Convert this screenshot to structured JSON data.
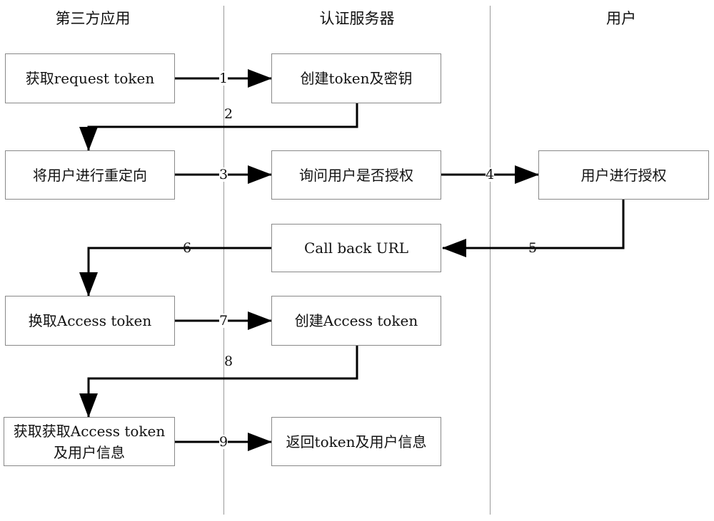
{
  "lanes": [
    {
      "title": "第三方应用"
    },
    {
      "title": "认证服务器"
    },
    {
      "title": "用户"
    }
  ],
  "boxes": {
    "get_request_token": "获取request token",
    "create_token_key": "创建token及密钥",
    "redirect_user": "将用户进行重定向",
    "ask_authorize": "询问用户是否授权",
    "user_authorize": "用户进行授权",
    "callback_url": "Call back URL",
    "exchange_access_token": "换取Access token",
    "create_access_token": "创建Access token",
    "get_access_token_info_line1": "获取获取Access token",
    "get_access_token_info_line2": "及用户信息",
    "return_token_info": "返回token及用户信息"
  },
  "steps": [
    "1",
    "2",
    "3",
    "4",
    "5",
    "6",
    "7",
    "8",
    "9"
  ]
}
